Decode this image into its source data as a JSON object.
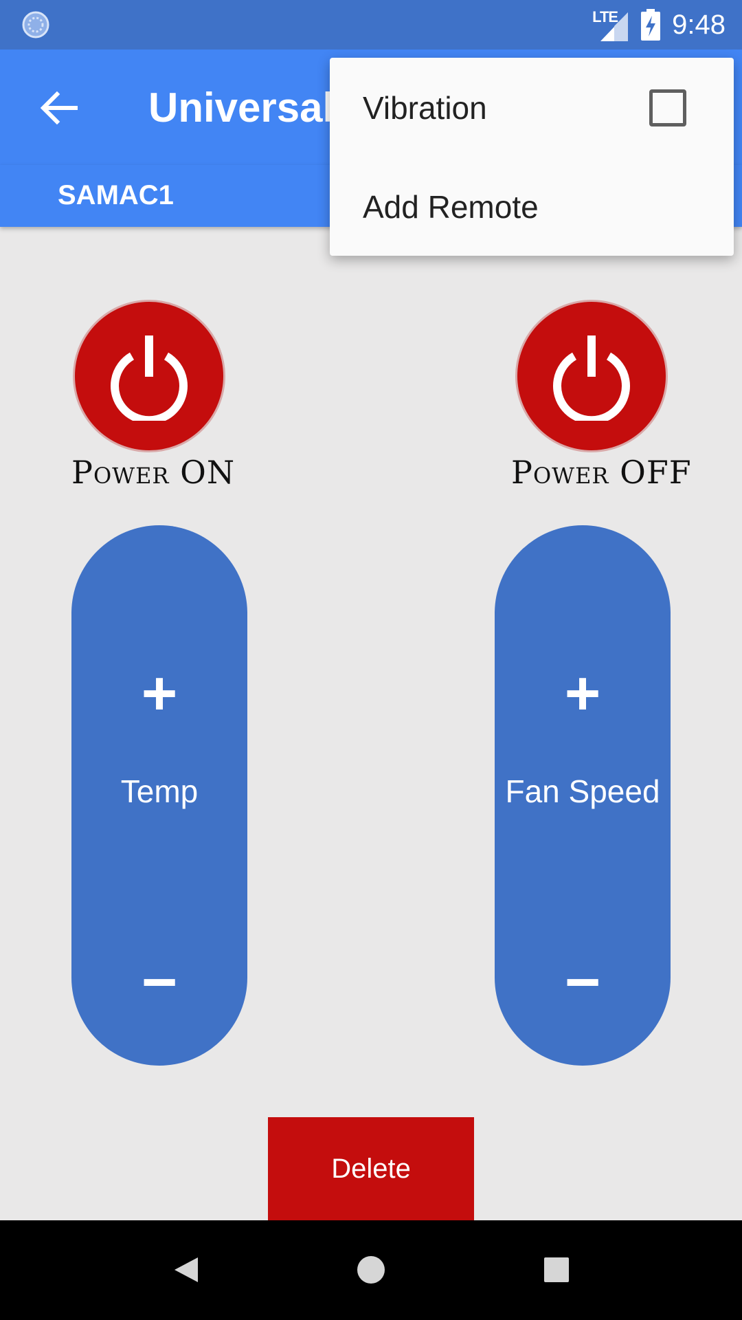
{
  "status_bar": {
    "network": "LTE",
    "time": "9:48"
  },
  "app_bar": {
    "title": "Universal",
    "tab": "SAMAC1"
  },
  "remote": {
    "power_on_label": "Power ON",
    "power_off_label": "Power OFF",
    "temp": {
      "label": "Temp",
      "plus": "+",
      "minus": "−"
    },
    "fan_speed": {
      "label": "Fan Speed",
      "plus": "+",
      "minus": "−"
    },
    "delete_label": "Delete"
  },
  "menu": {
    "vibration_label": "Vibration",
    "vibration_checked": false,
    "add_remote_label": "Add Remote"
  },
  "colors": {
    "status_bar": "#3f72c8",
    "app_bar": "#4285f4",
    "power_red": "#c40d0d",
    "pill_blue": "#4072c6",
    "background": "#e9e8e8"
  }
}
